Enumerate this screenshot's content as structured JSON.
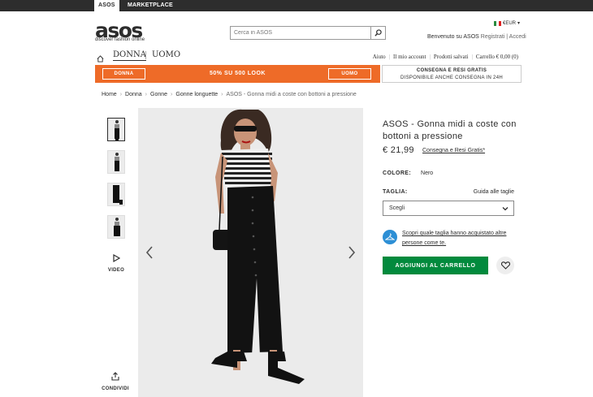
{
  "topbar": {
    "tab_asos": "ASOS",
    "tab_marketplace": "MARKETPLACE"
  },
  "header": {
    "logo": "asos",
    "logo_tagline": "discover fashion online",
    "search_placeholder": "Cerca in ASOS",
    "currency": "€EUR",
    "welcome": "Benvenuto su ASOS",
    "auth": "Registrati | Accedi"
  },
  "nav": {
    "gender_women": "DONNA",
    "gender_men": "UOMO",
    "links": [
      "Aiuto",
      "Il mio account",
      "Prodotti salvati",
      "Carrello € 0,00 (0)"
    ]
  },
  "promo": {
    "left_btn": "DONNA",
    "text": "50% SU 500 LOOK",
    "right_btn": "UOMO",
    "ship_line1": "CONSEGNA E RESI GRATIS",
    "ship_line2": "DISPONIBILE ANCHE CONSEGNA IN 24H"
  },
  "breadcrumb": [
    "Home",
    "Donna",
    "Gonne",
    "Gonne longuette",
    "ASOS - Gonna midi a coste con bottoni a pressione"
  ],
  "gallery": {
    "video_label": "VIDEO",
    "share_label": "CONDIVIDI"
  },
  "product": {
    "title": "ASOS - Gonna midi a coste con bottoni a pressione",
    "price": "€ 21,99",
    "shipping_link": "Consegna e Resi Gratis*",
    "color_label": "COLORE:",
    "color_value": "Nero",
    "size_label": "TAGLIA:",
    "size_guide": "Guida alle taglie",
    "size_select": "Scegli",
    "fit_text": "Scopri quale taglia hanno acquistato altre persone come te.",
    "add_to_cart": "AGGIUNGI AL CARRELLO"
  },
  "colors": {
    "brand_orange": "#ee6b28",
    "cta_green": "#028a3d",
    "fit_blue": "#2d8fd5"
  }
}
